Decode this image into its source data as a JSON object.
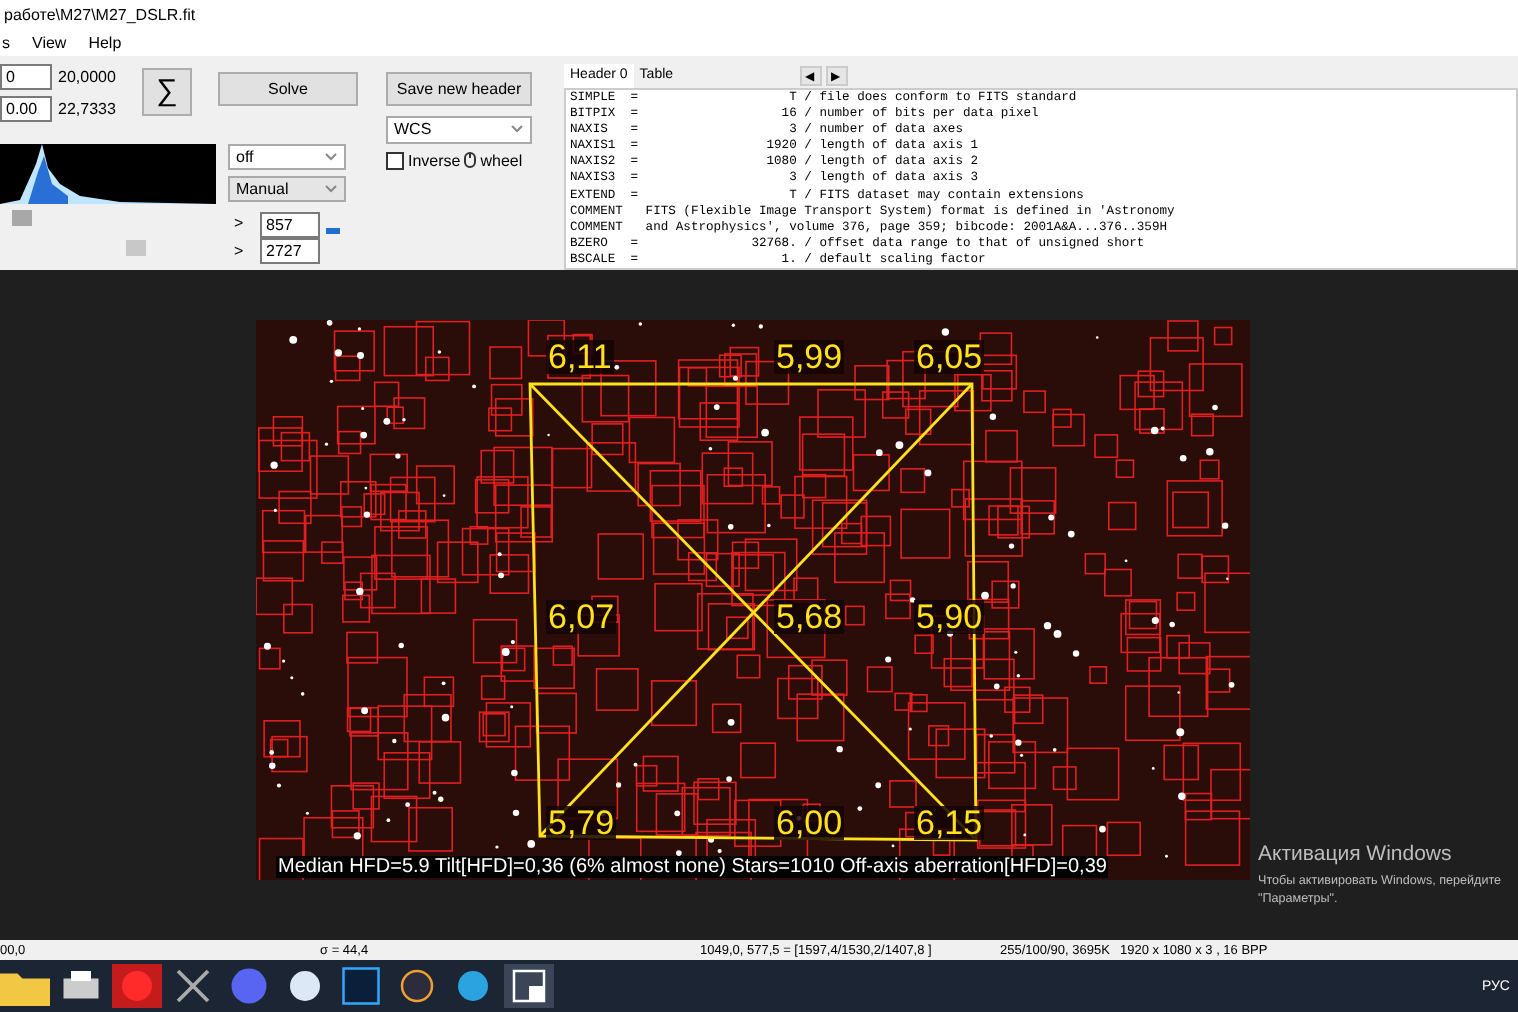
{
  "window": {
    "title": "работе\\M27\\M27_DSLR.fit"
  },
  "menu": [
    "s",
    "View",
    "Help"
  ],
  "coords": {
    "field_1": "0",
    "field_2": "0.00",
    "reading_1": "20,0000",
    "reading_2": "22,7333"
  },
  "sigma_button": "∑",
  "solve_button": "Solve",
  "save_header_button": "Save new header",
  "histogram_controls": {
    "dropdown_1": "off",
    "dropdown_2": "Manual",
    "arrow_1": ">",
    "arrow_2": ">",
    "max_field": "857",
    "min_field": "2727"
  },
  "wcs_dropdown": "WCS",
  "inverse_wheel": {
    "label": "Inverse",
    "suffix": "wheel",
    "checked": false
  },
  "header_tabs": [
    {
      "label": "Header 0",
      "selected": true
    },
    {
      "label": "Table",
      "selected": false
    }
  ],
  "nav_arrows": [
    "◀",
    "▶"
  ],
  "header_lines": [
    "SIMPLE  =                    T / file does conform to FITS standard",
    "BITPIX  =                   16 / number of bits per data pixel",
    "NAXIS   =                    3 / number of data axes",
    "NAXIS1  =                 1920 / length of data axis 1",
    "NAXIS2  =                 1080 / length of data axis 2",
    "NAXIS3  =                    3 / length of data axis 3",
    "EXTEND  =                    T / FITS dataset may contain extensions",
    "COMMENT   FITS (Flexible Image Transport System) format is defined in 'Astronomy",
    "COMMENT   and Astrophysics', volume 376, page 359; bibcode: 2001A&A...376..359H",
    "BZERO   =               32768. / offset data range to that of unsigned short",
    "BSCALE  =                   1. / default scaling factor"
  ],
  "image": {
    "tilt_labels": [
      [
        "6,11",
        "5,99",
        "6,05"
      ],
      [
        "6,07",
        "5,68",
        "5,90"
      ],
      [
        "5,79",
        "6,00",
        "6,15"
      ]
    ],
    "summary": "Median HFD=5.9  Tilt[HFD]=0,36 (6% almost none)  Stars=1010  Off-axis aberration[HFD]=0,39"
  },
  "activation": {
    "title": "Активация Windows",
    "line_1": "Чтобы активировать Windows, перейдите",
    "line_2": "\"Параметры\"."
  },
  "status_bar": [
    "00,0",
    "σ = 44,4",
    "1049,0, 577,5 = [1597,4/1530,2/1407,8 ]",
    "255/100/90, 3695K",
    "1920 x 1080 x 3 , 16 BPP"
  ],
  "tray": {
    "language": "РУС"
  }
}
